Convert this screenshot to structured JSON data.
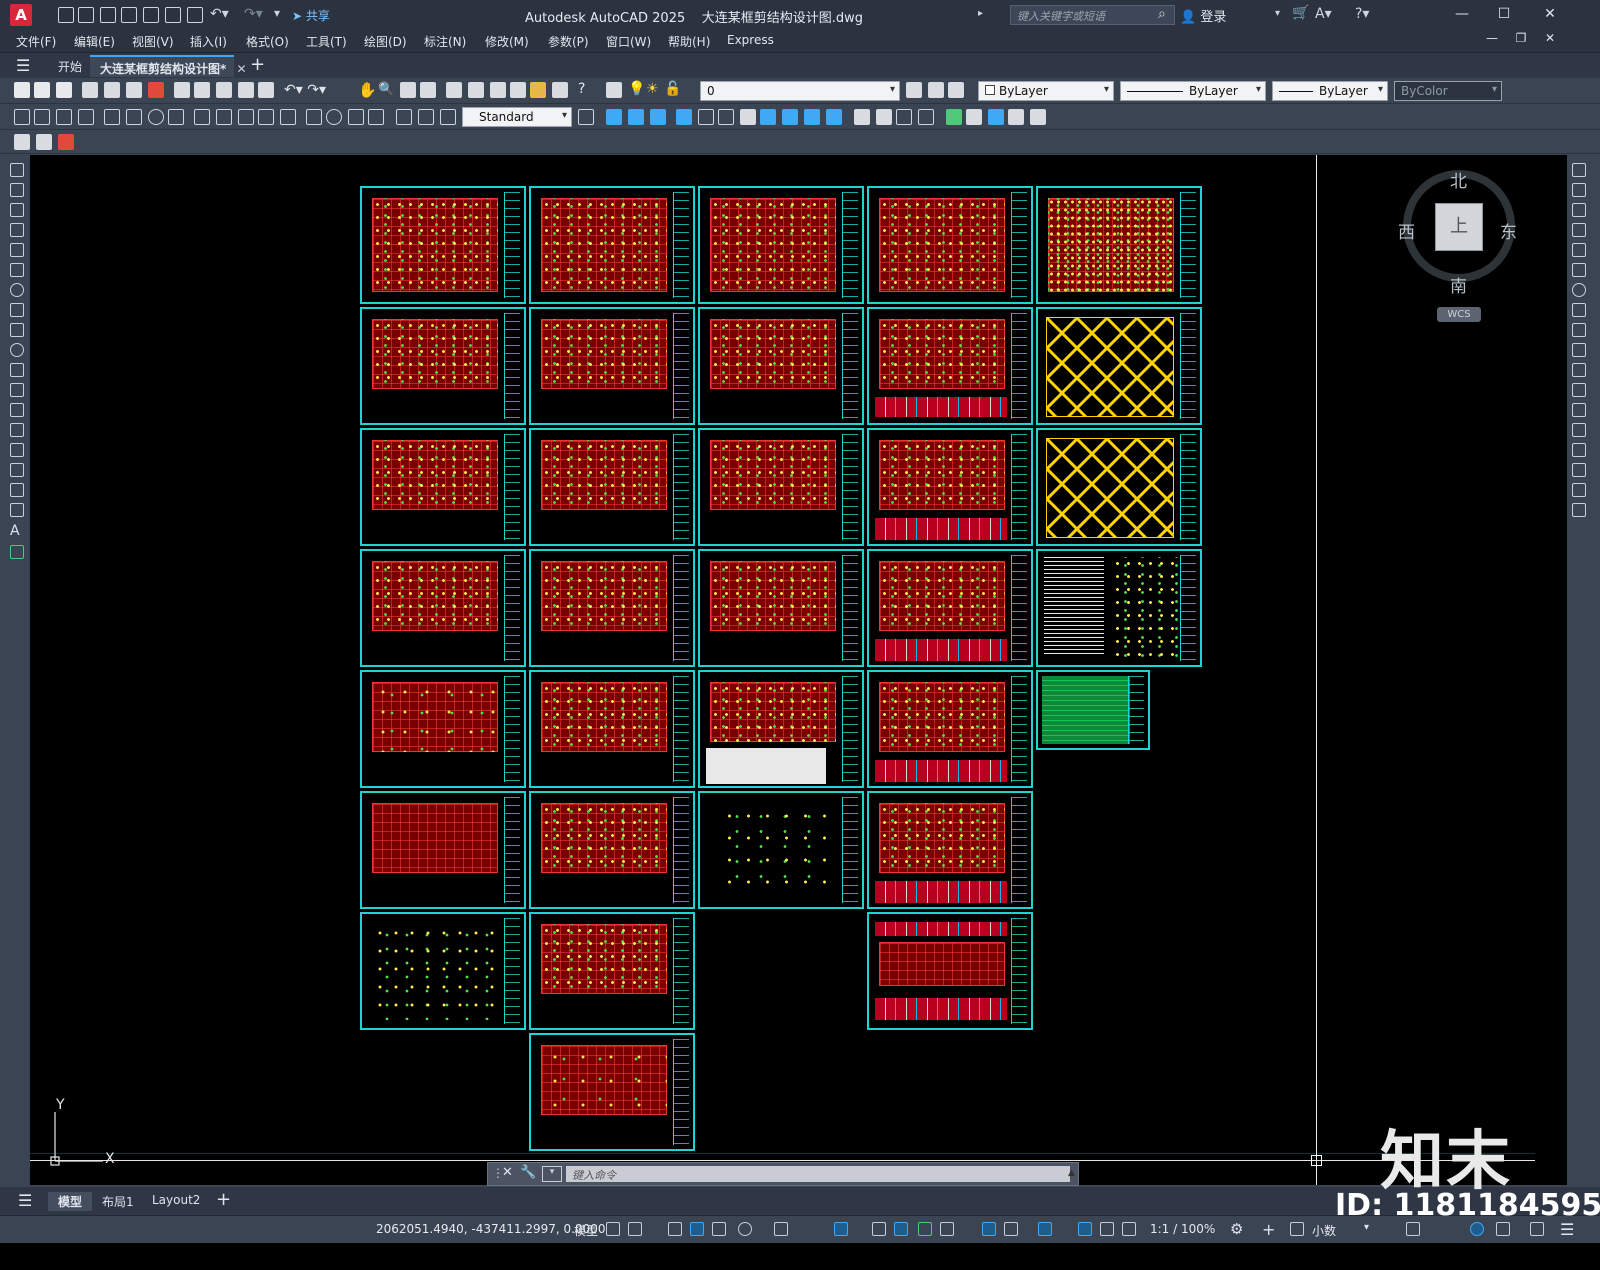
{
  "app": {
    "title": "Autodesk AutoCAD 2025",
    "filename": "大连某框剪结构设计图.dwg",
    "logo": "A",
    "share_label": "共享",
    "search_placeholder": "键入关键字或短语",
    "login_label": "登录"
  },
  "menu": [
    "文件(F)",
    "编辑(E)",
    "视图(V)",
    "插入(I)",
    "格式(O)",
    "工具(T)",
    "绘图(D)",
    "标注(N)",
    "修改(M)",
    "参数(P)",
    "窗口(W)",
    "帮助(H)",
    "Express"
  ],
  "tabs": {
    "start": "开始",
    "active_doc": "大连某框剪结构设计图*"
  },
  "toolbar": {
    "layer_value": "0",
    "color_value": "ByLayer",
    "linetype_value": "ByLayer",
    "lineweight_value": "ByLayer",
    "plotstyle_value": "ByColor",
    "dimstyle_value": "Standard"
  },
  "viewcube": {
    "north": "北",
    "south": "南",
    "east": "东",
    "west": "西",
    "top": "上",
    "wcs": "WCS"
  },
  "ucs": {
    "x": "X",
    "y": "Y"
  },
  "command": {
    "placeholder": "键入命令"
  },
  "layout_tabs": [
    "模型",
    "布局1",
    "Layout2"
  ],
  "status": {
    "coordinates": "2062051.4940, -437411.2997, 0.0000",
    "model_label": "模型",
    "scale": "1:1 / 100%",
    "units": "小数"
  },
  "watermark": {
    "logo": "知末",
    "id": "ID: 1181184595"
  },
  "colors": {
    "sheet_border": "#1fd3d0",
    "plan_red": "#7a0000",
    "accent_blue": "#3fa9f5"
  }
}
